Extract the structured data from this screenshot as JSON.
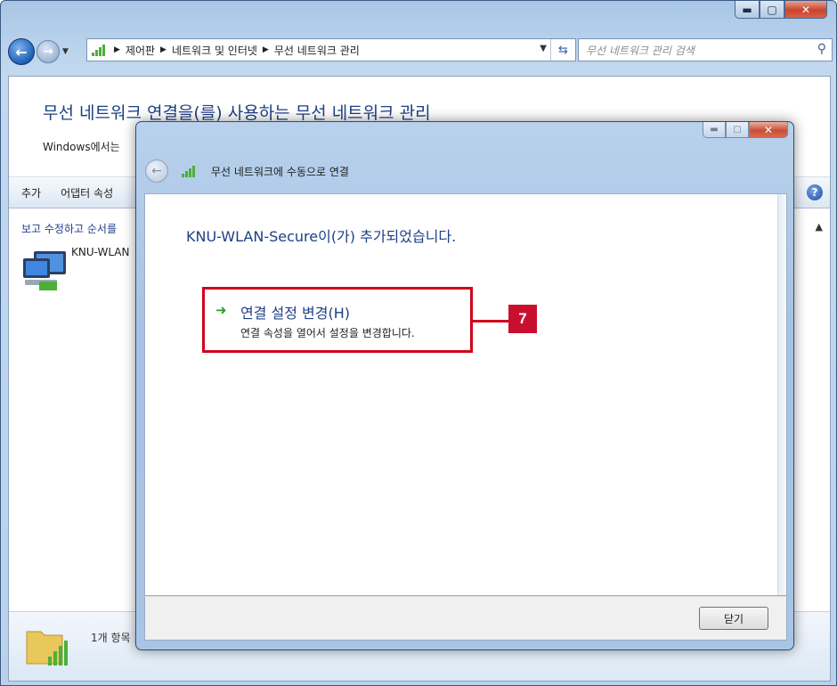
{
  "window": {
    "controls": {
      "minimize": "▬",
      "maximize": "▢",
      "close": "✕"
    }
  },
  "navigation": {
    "back_icon": "back-arrow-icon",
    "forward_icon": "forward-arrow-icon",
    "breadcrumbs": [
      "제어판",
      "네트워크 및 인터넷",
      "무선 네트워크 관리"
    ],
    "search_placeholder": "무선 네트워크 관리 검색"
  },
  "main": {
    "title": "무선 네트워크 연결을(를) 사용하는 무선 네트워크 관리",
    "description": "Windows에서는",
    "toolbar": [
      "추가",
      "어댑터 속성"
    ],
    "list_header": "보고 수정하고 순서를",
    "network_name": "KNU-WLAN",
    "status_text": "1개 항목"
  },
  "dialog": {
    "title": "무선 네트워크에 수동으로 연결",
    "heading": "KNU-WLAN-Secure이(가) 추가되었습니다.",
    "link_title": "연결 설정 변경(H)",
    "link_desc": "연결 속성을 열어서 설정을 변경합니다.",
    "close_button": "닫기",
    "callout_number": "7"
  },
  "colors": {
    "accent_blue": "#1e3f86",
    "highlight_red": "#d0021b",
    "arrow_green": "#2e9b2e"
  }
}
